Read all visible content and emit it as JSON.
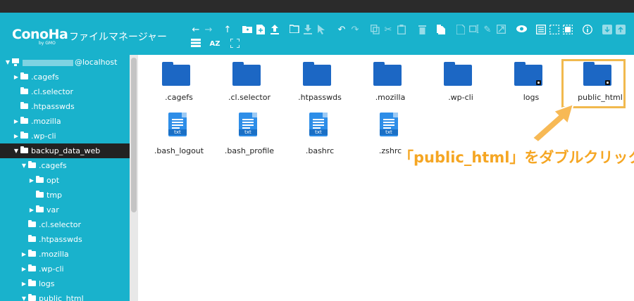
{
  "header": {
    "logo": "ConoHa",
    "logo_sub": "by GMO",
    "title": "ファイルマネージャー"
  },
  "sidebar": {
    "root": {
      "label": "@localhost",
      "expanded": true
    },
    "items": [
      {
        "label": ".cagefs",
        "caret": "right"
      },
      {
        "label": ".cl.selector",
        "caret": "none"
      },
      {
        "label": ".htpasswds",
        "caret": "none"
      },
      {
        "label": ".mozilla",
        "caret": "right"
      },
      {
        "label": ".wp-cli",
        "caret": "right"
      },
      {
        "label": "backup_data_web",
        "caret": "down",
        "selected": true
      },
      {
        "label": ".cagefs",
        "caret": "down"
      },
      {
        "label": "opt",
        "caret": "right"
      },
      {
        "label": "tmp",
        "caret": "none"
      },
      {
        "label": "var",
        "caret": "right"
      },
      {
        "label": ".cl.selector",
        "caret": "none"
      },
      {
        "label": ".htpasswds",
        "caret": "none"
      },
      {
        "label": ".mozilla",
        "caret": "right"
      },
      {
        "label": ".wp-cli",
        "caret": "right"
      },
      {
        "label": "logs",
        "caret": "right"
      },
      {
        "label": "public_html",
        "caret": "down"
      }
    ]
  },
  "files": {
    "folders": [
      {
        "name": ".cagefs",
        "locked": false
      },
      {
        "name": ".cl.selector",
        "locked": false
      },
      {
        "name": ".htpasswds",
        "locked": false
      },
      {
        "name": ".mozilla",
        "locked": false
      },
      {
        "name": ".wp-cli",
        "locked": false
      },
      {
        "name": "logs",
        "locked": true
      },
      {
        "name": "public_html",
        "locked": true
      }
    ],
    "documents": [
      {
        "name": ".bash_logout",
        "ext": "txt"
      },
      {
        "name": ".bash_profile",
        "ext": "txt"
      },
      {
        "name": ".bashrc",
        "ext": "txt"
      },
      {
        "name": ".zshrc",
        "ext": "txt"
      }
    ]
  },
  "annotation": {
    "text": "「public_html」をダブルクリック",
    "color": "#f5a623"
  },
  "colors": {
    "header_bg": "#19b2cc",
    "sidebar_bg": "#19b2cc",
    "folder": "#1c67c4",
    "document": "#2e8ee8",
    "highlight": "#f1b94e"
  }
}
